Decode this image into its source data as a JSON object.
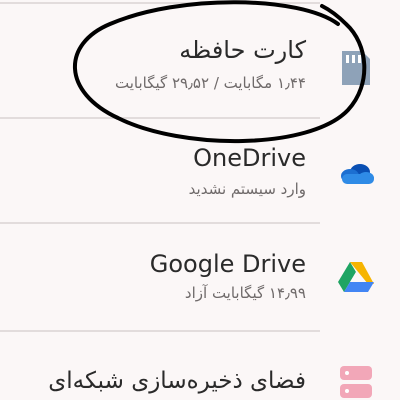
{
  "storage_list": {
    "items": [
      {
        "id": "memory-card",
        "title": "کارت حافظه",
        "subtitle": "۱٫۴۴ مگابایت / ۲۹٫۵۲ گیگابایت",
        "icon": "sd-card-icon"
      },
      {
        "id": "onedrive",
        "title": "OneDrive",
        "subtitle": "وارد سیستم نشدید",
        "icon": "onedrive-cloud-icon"
      },
      {
        "id": "google-drive",
        "title": "Google Drive",
        "subtitle": "۱۴٫۹۹ گیگابایت آزاد",
        "icon": "google-drive-icon"
      },
      {
        "id": "network-storage",
        "title": "فضای ذخیره‌سازی شبکه‌ای",
        "subtitle": "",
        "icon": "network-storage-icon"
      }
    ]
  },
  "annotation": {
    "kind": "hand-drawn-circle",
    "color": "#000000"
  },
  "colors": {
    "background": "#fbf7f7",
    "divider": "#e2dcdc",
    "title": "#2a2a2a",
    "subtitle": "#6f6a6a",
    "sd_card": "#8ea2b8",
    "onedrive_blue": "#1c6fd1",
    "network_pink": "#f2a7b8"
  }
}
